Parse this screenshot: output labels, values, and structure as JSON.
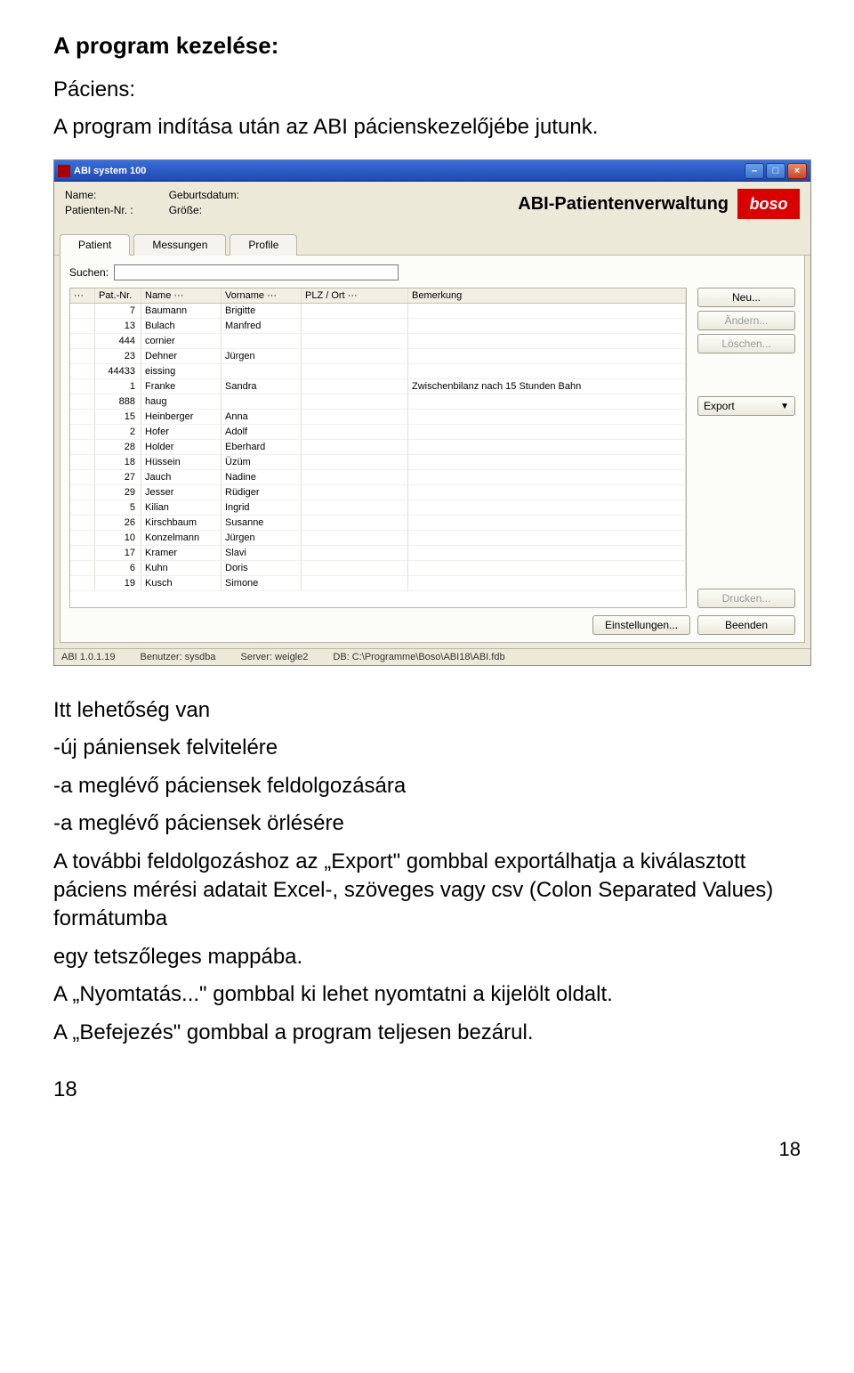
{
  "doc": {
    "heading": "A program kezelése:",
    "subheading": "Páciens:",
    "intro": "A program indítása után az ABI pácienskezelőjébe jutunk.",
    "after": {
      "possibility": "Itt lehetőség van",
      "bul1": "-új pániensek felvitelére",
      "bul2": "-a meglévő páciensek feldolgozására",
      "bul3": "-a meglévő páciensek örlésére",
      "p4": "A további feldolgozáshoz az „Export\"  gombbal exportálhatja a kiválasztott páciens mérési adatait Excel-, szöveges vagy csv (Colon Separated Values) formátumba",
      "p5": "egy tetszőleges mappába.",
      "p6": "A „Nyomtatás...\" gombbal ki lehet nyomtatni a kijelölt oldalt.",
      "p7": "A „Befejezés\" gombbal a program teljesen bezárul.",
      "pagenum_left": "18",
      "pagenum_right": "18"
    }
  },
  "app": {
    "title": "ABI system 100",
    "topinfo": {
      "name_label": "Name:",
      "patnr_label": "Patienten-Nr. :",
      "geb_label": "Geburtsdatum:",
      "groesse_label": "Größe:"
    },
    "abi_title": "ABI-Patientenverwaltung",
    "logo": "boso",
    "tabs": {
      "t1": "Patient",
      "t2": "Messungen",
      "t3": "Profile"
    },
    "search_label": "Suchen:",
    "columns": {
      "c0": "···",
      "c1": "Pat.-Nr.",
      "c2": "Name ···",
      "c3": "Vorname ···",
      "c4": "PLZ / Ort ···",
      "c5": "Bemerkung"
    },
    "rows": [
      {
        "nr": "7",
        "name": "Baumann",
        "vor": "Brigitte",
        "ort": "",
        "bem": ""
      },
      {
        "nr": "13",
        "name": "Bulach",
        "vor": "Manfred",
        "ort": "",
        "bem": ""
      },
      {
        "nr": "444",
        "name": "cornier",
        "vor": "",
        "ort": "",
        "bem": ""
      },
      {
        "nr": "23",
        "name": "Dehner",
        "vor": "Jürgen",
        "ort": "",
        "bem": ""
      },
      {
        "nr": "44433",
        "name": "eissing",
        "vor": "",
        "ort": "",
        "bem": ""
      },
      {
        "nr": "1",
        "name": "Franke",
        "vor": "Sandra",
        "ort": "",
        "bem": "Zwischenbilanz nach 15 Stunden Bahn"
      },
      {
        "nr": "888",
        "name": "haug",
        "vor": "",
        "ort": "",
        "bem": ""
      },
      {
        "nr": "15",
        "name": "Heinberger",
        "vor": "Anna",
        "ort": "",
        "bem": ""
      },
      {
        "nr": "2",
        "name": "Hofer",
        "vor": "Adolf",
        "ort": "",
        "bem": ""
      },
      {
        "nr": "28",
        "name": "Holder",
        "vor": "Eberhard",
        "ort": "",
        "bem": ""
      },
      {
        "nr": "18",
        "name": "Hüssein",
        "vor": "Üzüm",
        "ort": "",
        "bem": ""
      },
      {
        "nr": "27",
        "name": "Jauch",
        "vor": "Nadine",
        "ort": "",
        "bem": ""
      },
      {
        "nr": "29",
        "name": "Jesser",
        "vor": "Rüdiger",
        "ort": "",
        "bem": ""
      },
      {
        "nr": "5",
        "name": "Kilian",
        "vor": "Ingrid",
        "ort": "",
        "bem": ""
      },
      {
        "nr": "26",
        "name": "Kirschbaum",
        "vor": "Susanne",
        "ort": "",
        "bem": ""
      },
      {
        "nr": "10",
        "name": "Konzelmann",
        "vor": "Jürgen",
        "ort": "",
        "bem": ""
      },
      {
        "nr": "17",
        "name": "Kramer",
        "vor": "Slavi",
        "ort": "",
        "bem": ""
      },
      {
        "nr": "6",
        "name": "Kuhn",
        "vor": "Doris",
        "ort": "",
        "bem": ""
      },
      {
        "nr": "19",
        "name": "Kusch",
        "vor": "Simone",
        "ort": "",
        "bem": ""
      }
    ],
    "buttons": {
      "neu": "Neu...",
      "aendern": "Ändern...",
      "loeschen": "Löschen...",
      "export": "Export",
      "drucken": "Drucken...",
      "einstellungen": "Einstellungen...",
      "beenden": "Beenden"
    },
    "status": {
      "s1": "ABI 1.0.1.19",
      "s2": "Benutzer: sysdba",
      "s3": "Server: weigle2",
      "s4": "DB: C:\\Programme\\Boso\\ABI18\\ABI.fdb"
    }
  }
}
